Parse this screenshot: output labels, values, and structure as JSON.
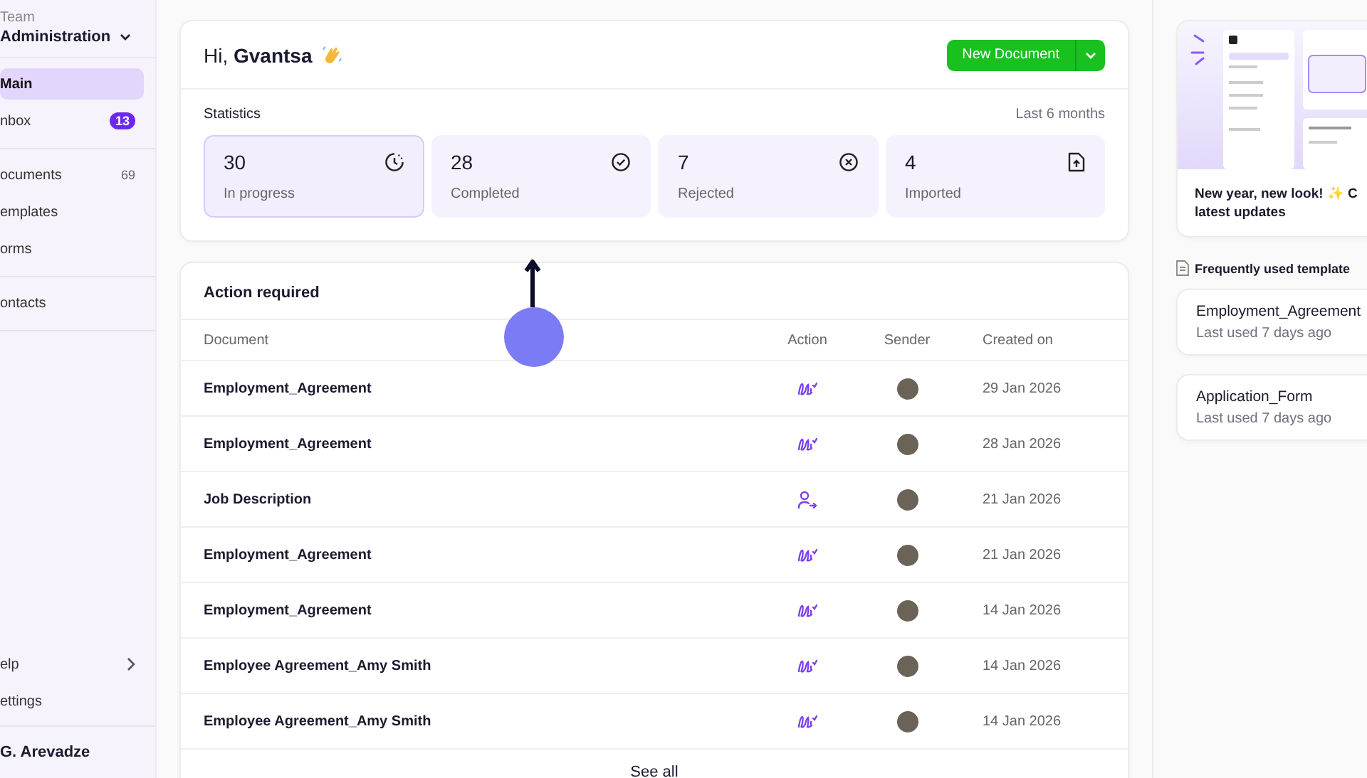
{
  "sidebar": {
    "team_label": "Team",
    "team_name": "Administration",
    "sections": [
      [
        {
          "label": "Main",
          "selected": true
        },
        {
          "label": "nbox",
          "selected": false,
          "badge": "13"
        }
      ],
      [
        {
          "label": "ocuments",
          "selected": false,
          "count": "69"
        },
        {
          "label": "emplates",
          "selected": false
        },
        {
          "label": "orms",
          "selected": false
        }
      ],
      [
        {
          "label": "ontacts",
          "selected": false
        }
      ]
    ],
    "bottom_items": [
      {
        "label": "elp",
        "expandable": true
      },
      {
        "label": "ettings",
        "expandable": false
      }
    ],
    "user_name": "G. Arevadze"
  },
  "greeting": "Hi, **Gvantsa**",
  "new_document_button": "New Document",
  "statistics": {
    "title": "Statistics",
    "period": "Last 6 months",
    "cards": [
      {
        "kind": "progress",
        "value": "30",
        "label": "In progress",
        "selected": true
      },
      {
        "kind": "completed",
        "value": "28",
        "label": "Completed",
        "selected": false
      },
      {
        "kind": "rejected",
        "value": "7",
        "label": "Rejected",
        "selected": false
      },
      {
        "kind": "imported",
        "value": "4",
        "label": "Imported",
        "selected": false
      }
    ]
  },
  "action_required": {
    "title": "Action required",
    "columns": [
      "Document",
      "Action",
      "Sender",
      "Created on"
    ],
    "rows": [
      {
        "document": "Employment_Agreement",
        "kind": "sign",
        "created_on": "29 Jan 2026"
      },
      {
        "document": "Employment_Agreement",
        "kind": "sign",
        "created_on": "28 Jan 2026"
      },
      {
        "document": "Job Description",
        "kind": "assign",
        "created_on": "21 Jan 2026"
      },
      {
        "document": "Employment_Agreement",
        "kind": "sign",
        "created_on": "21 Jan 2026"
      },
      {
        "document": "Employment_Agreement",
        "kind": "sign",
        "created_on": "14 Jan 2026"
      },
      {
        "document": "Employee Agreement_Amy Smith",
        "kind": "sign",
        "created_on": "14 Jan 2026"
      },
      {
        "document": "Employee Agreement_Amy Smith",
        "kind": "sign",
        "created_on": "14 Jan 2026"
      }
    ],
    "see_all": "See all"
  },
  "news": {
    "text": "New year, new look! ✨ C",
    "text_line_2": "latest updates"
  },
  "templates": {
    "title": "Frequently used template",
    "items": [
      {
        "name": "Employment_Agreement",
        "last_used": "Last used 7 days ago"
      },
      {
        "name": "Application_Form",
        "last_used": "Last used 7 days ago"
      }
    ]
  }
}
